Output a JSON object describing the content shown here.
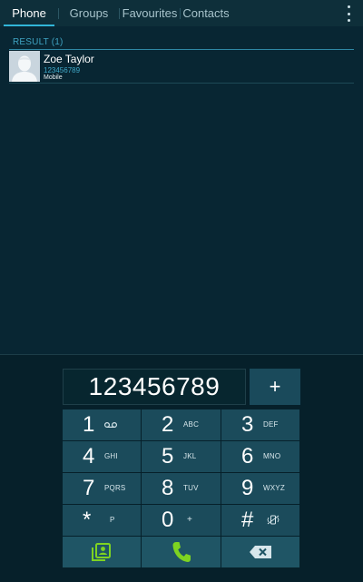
{
  "tabs": [
    {
      "label": "Phone",
      "active": true
    },
    {
      "label": "Groups",
      "active": false
    },
    {
      "label": "Favourites",
      "active": false
    },
    {
      "label": "Contacts",
      "active": false
    }
  ],
  "results": {
    "header": "RESULT (1)",
    "contacts": [
      {
        "name": "Zoe Taylor",
        "number": "123456789",
        "type": "Mobile",
        "avatar_icon": "default-person-avatar"
      }
    ]
  },
  "dialer": {
    "number": "123456789",
    "add_label": "+",
    "keys": [
      {
        "digit": "1",
        "letters": "",
        "icon": "voicemail-icon"
      },
      {
        "digit": "2",
        "letters": "ABC"
      },
      {
        "digit": "3",
        "letters": "DEF"
      },
      {
        "digit": "4",
        "letters": "GHI"
      },
      {
        "digit": "5",
        "letters": "JKL"
      },
      {
        "digit": "6",
        "letters": "MNO"
      },
      {
        "digit": "7",
        "letters": "PQRS"
      },
      {
        "digit": "8",
        "letters": "TUV"
      },
      {
        "digit": "9",
        "letters": "WXYZ"
      },
      {
        "digit": "*",
        "letters": "P"
      },
      {
        "digit": "0",
        "letters": "+"
      },
      {
        "digit": "#",
        "letters": "",
        "icon": "vibrate-mute-icon"
      }
    ],
    "actions": [
      {
        "name": "contacts-shortcut-button",
        "icon": "contact-card-icon"
      },
      {
        "name": "call-button",
        "icon": "phone-icon"
      },
      {
        "name": "backspace-button",
        "icon": "backspace-icon"
      }
    ]
  },
  "colors": {
    "accent": "#31b6d8",
    "key_bg": "#1b4b5b",
    "call_green": "#7ed321",
    "bg": "#0b2530"
  }
}
